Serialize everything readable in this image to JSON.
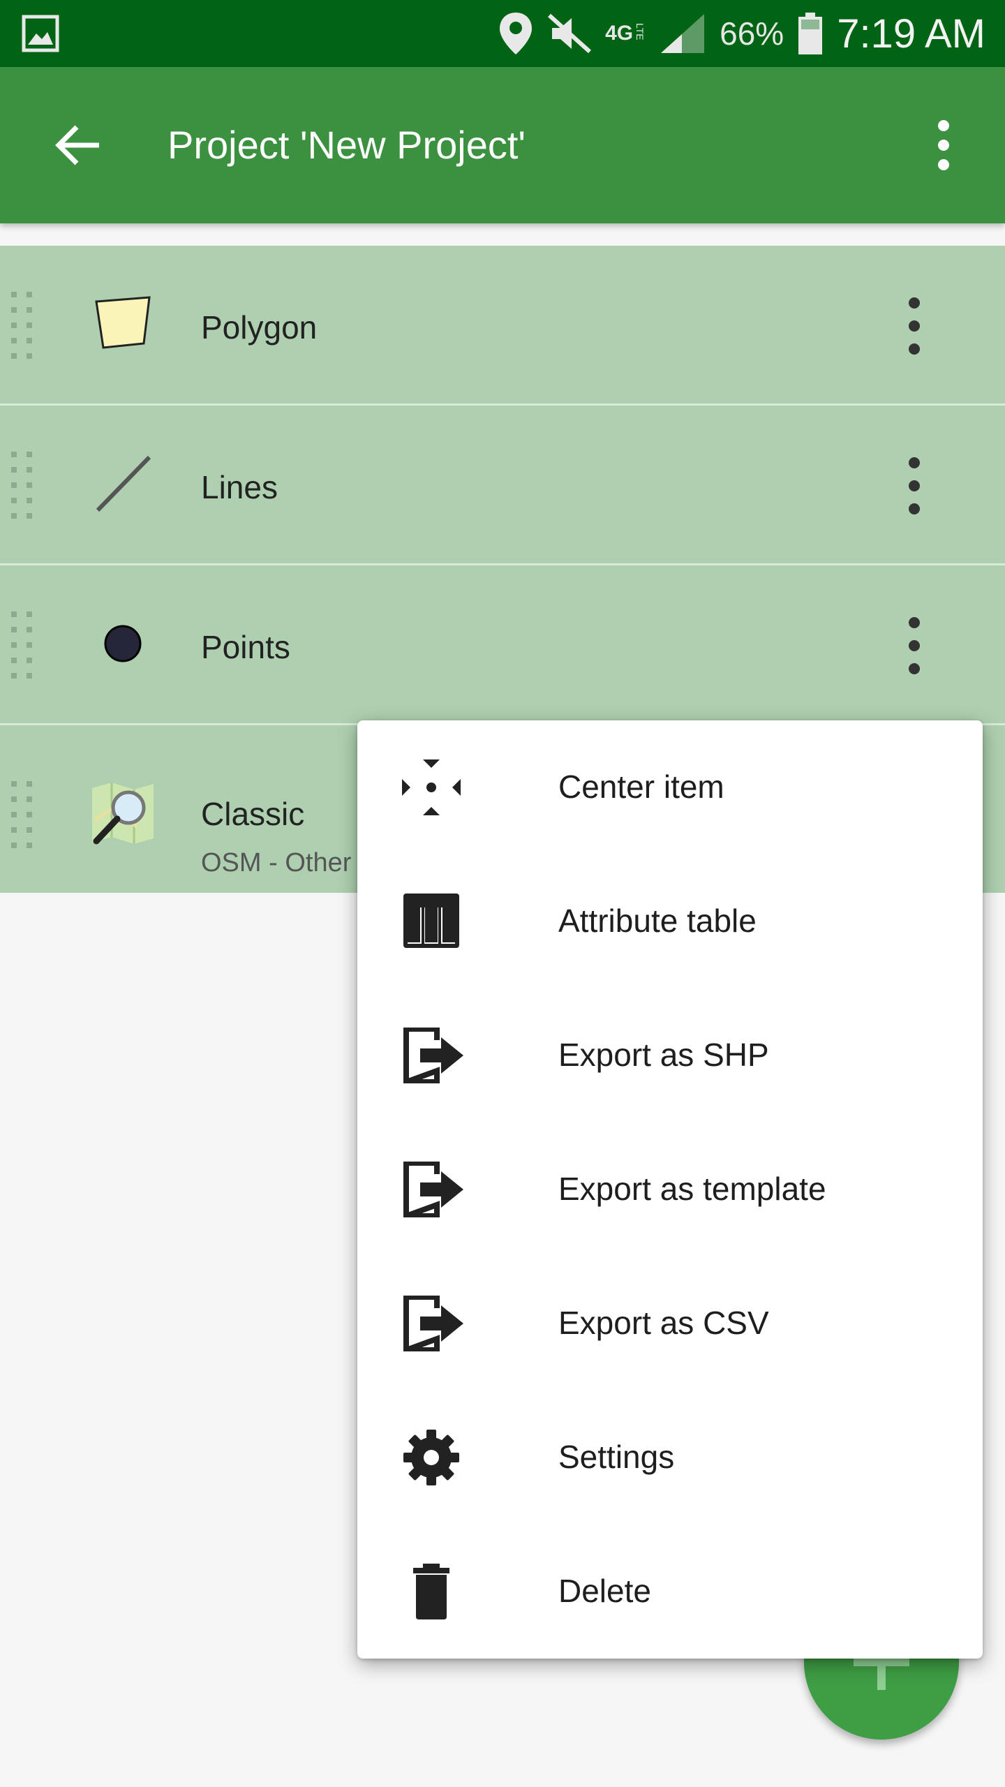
{
  "status_bar": {
    "network": "4G",
    "network_sub": "LTE",
    "battery": "66%",
    "time": "7:19 AM",
    "icons": [
      "gallery-icon",
      "location-icon",
      "mute-icon",
      "network-icon",
      "signal-icon",
      "battery-icon"
    ]
  },
  "app_bar": {
    "title": "Project 'New Project'",
    "back_icon": "arrow-back-icon",
    "menu_icon": "more-vert-icon",
    "color": "#3b9140"
  },
  "layers": [
    {
      "label": "Polygon",
      "icon": "polygon-icon"
    },
    {
      "label": "Lines",
      "icon": "line-icon"
    },
    {
      "label": "Points",
      "icon": "point-icon"
    },
    {
      "label": "Classic",
      "sublabel": "OSM - Other",
      "icon": "map-search-icon"
    }
  ],
  "context_menu": {
    "items": [
      {
        "label": "Center item",
        "icon": "center-focus-icon"
      },
      {
        "label": "Attribute table",
        "icon": "table-icon"
      },
      {
        "label": "Export as SHP",
        "icon": "export-icon"
      },
      {
        "label": "Export as template",
        "icon": "export-icon"
      },
      {
        "label": "Export as CSV",
        "icon": "export-icon"
      },
      {
        "label": "Settings",
        "icon": "gear-icon"
      },
      {
        "label": "Delete",
        "icon": "trash-icon"
      }
    ]
  },
  "fab": {
    "icon": "plus-icon",
    "color": "#3e9e44"
  },
  "colors": {
    "status_bar": "#006414",
    "row_background": "#aed0b0",
    "page_background": "#f6f6f6"
  }
}
